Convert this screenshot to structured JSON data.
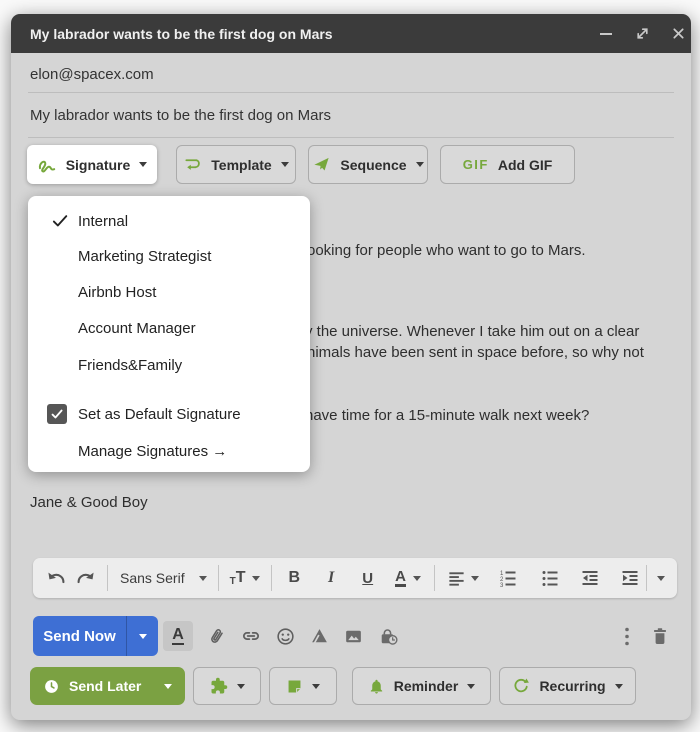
{
  "window": {
    "title": "My labrador wants to be the first dog on Mars"
  },
  "fields": {
    "to": "elon@spacex.com",
    "subject": "My labrador wants to be the first dog on Mars"
  },
  "action_bar": {
    "signature_label": "Signature",
    "template_label": "Template",
    "sequence_label": "Sequence",
    "gif_badge": "GIF",
    "add_gif_label": "Add GIF"
  },
  "signature_menu": {
    "items": [
      {
        "label": "Internal",
        "checked": true
      },
      {
        "label": "Marketing Strategist",
        "checked": false
      },
      {
        "label": "Airbnb Host",
        "checked": false
      },
      {
        "label": "Account Manager",
        "checked": false
      },
      {
        "label": "Friends&Family",
        "checked": false
      }
    ],
    "set_default_label": "Set as Default Signature",
    "set_default_checked": true,
    "manage_label": "Manage Signatures →"
  },
  "body": {
    "visible_fragments": [
      "ooking for people who want to go to Mars.",
      "y the universe. Whenever I take him out on a clear",
      "nimals have been sent in space before, so why not",
      "have time for a 15-minute walk next week?"
    ],
    "signature_closing": "Jane & Good Boy"
  },
  "format_toolbar": {
    "font_family_label": "Sans Serif",
    "size_label_small": "T",
    "size_label_large": "T",
    "bold_label": "B",
    "italic_label": "I",
    "underline_label": "U",
    "text_color_label": "A"
  },
  "send_row": {
    "send_now_label": "Send Now",
    "text_format_label": "A"
  },
  "schedule_row": {
    "send_later_label": "Send Later",
    "reminder_label": "Reminder",
    "recurring_label": "Recurring"
  },
  "colors": {
    "titlebar": "#3b3b3b",
    "window_background": "#d5d5d5",
    "accent_green": "#77a83c",
    "send_now_blue": "#3e6fd4",
    "send_later_green": "#7ba142",
    "menu_background": "#ffffff"
  },
  "icons": {
    "minimize-icon": "–",
    "expand-icon": "⤢",
    "close-icon": "✕",
    "signature-icon": "green scribble",
    "template-icon": "lines with return arrow",
    "sequence-icon": "paper plane",
    "checkmark-icon": "✓",
    "checkbox-checked-icon": "☑",
    "undo-icon": "↶",
    "redo-icon": "↷",
    "font-size-icon": "TT",
    "align-left-icon": "≡",
    "numbered-list-icon": "1 2 3 list",
    "bullet-list-icon": "• list",
    "outdent-icon": "⇤",
    "indent-icon": "⇥",
    "attachment-icon": "paperclip",
    "link-icon": "chain link",
    "emoji-icon": "smiley face",
    "drive-icon": "drive triangle",
    "insert-image-icon": "photo",
    "confidential-icon": "lock with clock",
    "more-options-icon": "⋮",
    "trash-icon": "trash can",
    "clock-icon": "clock",
    "puzzle-icon": "puzzle piece",
    "note-icon": "sticky note",
    "bell-icon": "bell",
    "recurring-icon": "circular arrow"
  }
}
